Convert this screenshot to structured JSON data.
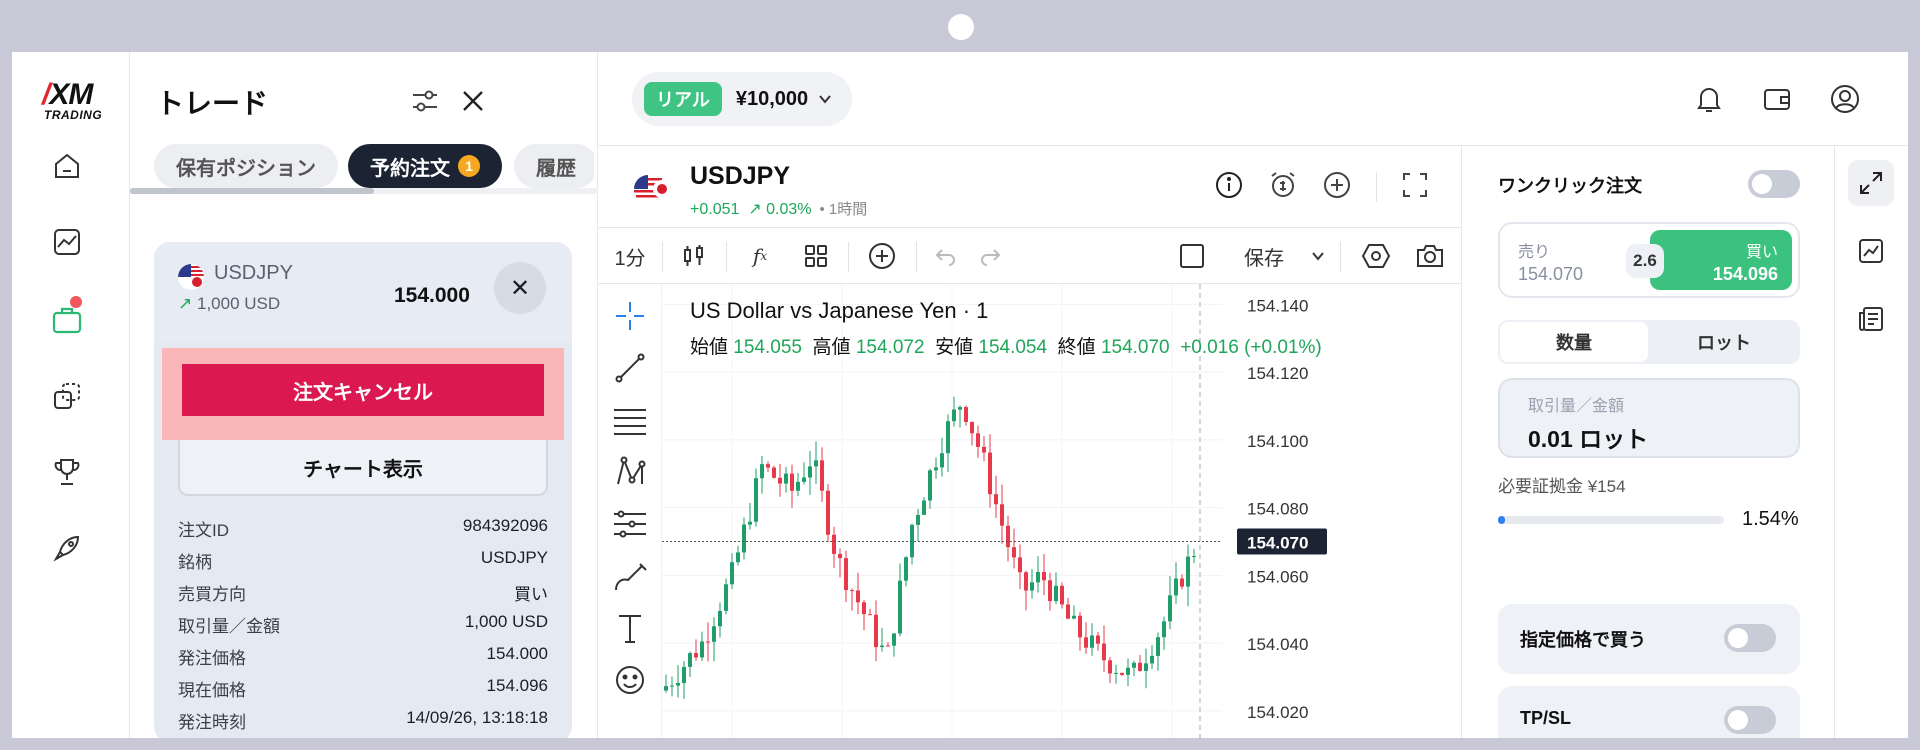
{
  "brand": {
    "logo_xm": "XM",
    "logo_sub": "TRADING"
  },
  "nav": {
    "items": [
      "home",
      "chart",
      "portfolio",
      "copy",
      "trophy",
      "rocket"
    ]
  },
  "trade_panel": {
    "title": "トレード",
    "tabs": [
      {
        "label": "保有ポジション"
      },
      {
        "label": "予約注文",
        "badge": "1"
      },
      {
        "label": "履歴"
      }
    ],
    "order": {
      "symbol": "USDJPY",
      "amount_text": "1,000 USD",
      "price": "154.000",
      "cancel_label": "注文キャンセル",
      "chart_label": "チャート表示",
      "details": [
        {
          "label": "注文ID",
          "value": "984392096"
        },
        {
          "label": "銘柄",
          "value": "USDJPY"
        },
        {
          "label": "売買方向",
          "value": "買い"
        },
        {
          "label": "取引量／金額",
          "value": "1,000 USD"
        },
        {
          "label": "発注価格",
          "value": "154.000"
        },
        {
          "label": "現在価格",
          "value": "154.096"
        },
        {
          "label": "発注時刻",
          "value": "14/09/26, 13:18:18"
        }
      ]
    }
  },
  "topbar": {
    "account_type": "リアル",
    "balance": "¥10,000"
  },
  "chart_header": {
    "symbol": "USDJPY",
    "change": "+0.051",
    "change_pct": "0.03%",
    "timeframe": "• 1時間"
  },
  "toolbar": {
    "interval": "1分",
    "fx": "f",
    "save": "保存"
  },
  "chart": {
    "title": "US Dollar vs Japanese Yen · 1",
    "open_label": "始値",
    "open": "154.055",
    "high_label": "高値",
    "high": "154.072",
    "low_label": "安値",
    "low": "154.054",
    "close_label": "終値",
    "close": "154.070",
    "delta": "+0.016 (+0.01%)",
    "last_price": "154.070",
    "y_ticks": [
      "154.140",
      "154.120",
      "154.100",
      "154.080",
      "154.060",
      "154.040",
      "154.020"
    ]
  },
  "chart_data": {
    "type": "candlestick",
    "title": "US Dollar vs Japanese Yen · 1",
    "ylim": [
      154.012,
      154.146
    ],
    "y_ticks": [
      154.14,
      154.12,
      154.1,
      154.08,
      154.06,
      154.04,
      154.02
    ],
    "last": 154.07,
    "colors": {
      "up": "#1f9d6b",
      "down": "#e8394b"
    }
  },
  "order_panel": {
    "one_click_label": "ワンクリック注文",
    "sell_label": "売り",
    "sell_price": "154.070",
    "buy_label": "買い",
    "buy_price": "154.096",
    "spread": "2.6",
    "seg_qty": "数量",
    "seg_lot": "ロット",
    "lot_label": "取引量／金額",
    "lot_value": "0.01 ロット",
    "margin_text": "必要証拠金 ¥154",
    "margin_fraction": 0.0154,
    "margin_pct": "1.54%",
    "limit_label": "指定価格で買う",
    "tpsl_label": "TP/SL"
  },
  "colors": {
    "accent_green": "#3cc27f",
    "cancel_red": "#dc1850",
    "highlight": "#fbb7b7",
    "dark_tab": "#1c2333"
  }
}
